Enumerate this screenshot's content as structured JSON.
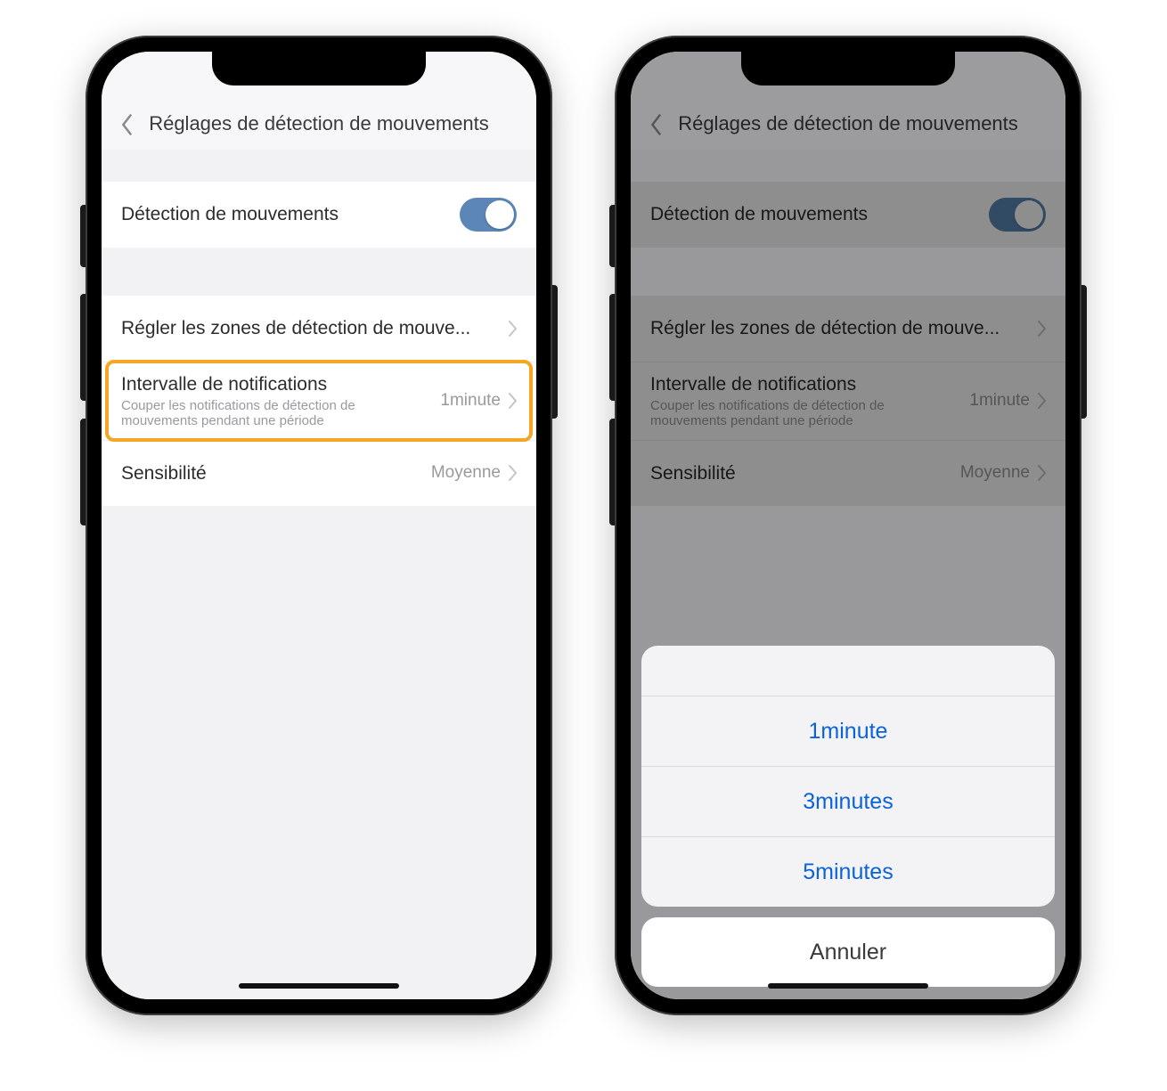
{
  "left": {
    "header": {
      "title": "Réglages de détection de mouvements"
    },
    "rows": {
      "motion_detect": {
        "label": "Détection de mouvements",
        "on": true
      },
      "zones": {
        "label": "Régler les zones de détection de mouve..."
      },
      "interval": {
        "label": "Intervalle de notifications",
        "sub": "Couper les notifications de détection de mouvements pendant une période",
        "value": "1minute"
      },
      "sensitivity": {
        "label": "Sensibilité",
        "value": "Moyenne"
      }
    }
  },
  "right": {
    "header": {
      "title": "Réglages de détection de mouvements"
    },
    "rows": {
      "motion_detect": {
        "label": "Détection de mouvements",
        "on": true
      },
      "zones": {
        "label": "Régler les zones de détection de mouve..."
      },
      "interval": {
        "label": "Intervalle de notifications",
        "sub": "Couper les notifications de détection de mouvements pendant une période",
        "value": "1minute"
      },
      "sensitivity": {
        "label": "Sensibilité",
        "value": "Moyenne"
      }
    },
    "sheet": {
      "options": [
        "1minute",
        "3minutes",
        "5minutes"
      ],
      "cancel": "Annuler"
    }
  },
  "colors": {
    "accent": "#5b86b6",
    "highlight": "#f5a623",
    "link": "#0b63d6"
  }
}
